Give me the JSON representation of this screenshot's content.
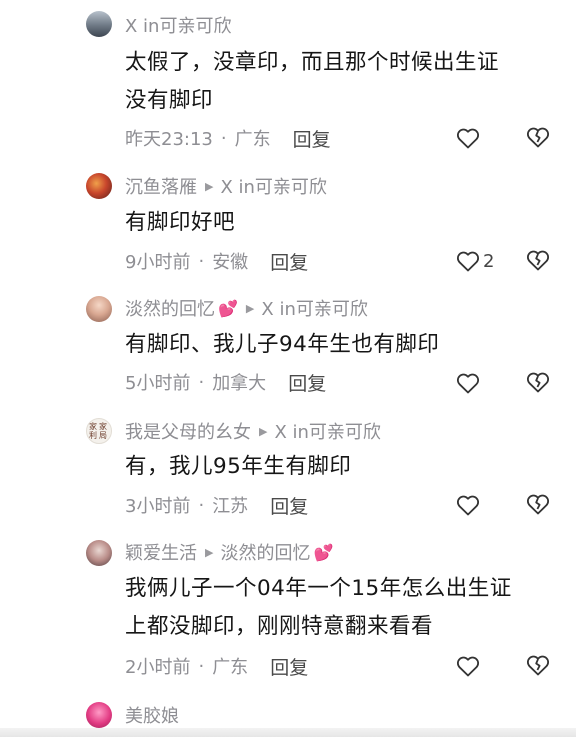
{
  "comments": [
    {
      "avatar_icon": "mountain-avatar",
      "author": "",
      "reply_to": "X in可亲可欣",
      "author_emoji": "",
      "lines": [
        "太假了，没章印，而且那个时候出生证",
        "没有脚印"
      ],
      "time": "昨天23:13",
      "location": "广东",
      "reply_label": "回复",
      "like_count": ""
    },
    {
      "avatar_icon": "flower-avatar",
      "author": "沉鱼落雁",
      "reply_to": "X in可亲可欣",
      "author_emoji": "",
      "lines": [
        "有脚印好吧"
      ],
      "time": "9小时前",
      "location": "安徽",
      "reply_label": "回复",
      "like_count": "2"
    },
    {
      "avatar_icon": "portrait-avatar",
      "author": "淡然的回忆",
      "reply_to": "X in可亲可欣",
      "author_emoji": "💕",
      "lines": [
        "有脚印、我儿子94年生也有脚印"
      ],
      "time": "5小时前",
      "location": "加拿大",
      "reply_label": "回复",
      "like_count": ""
    },
    {
      "avatar_icon": "calligraphy-avatar",
      "avatar_text": "家家利局",
      "author": "我是父母的幺女",
      "reply_to": "X in可亲可欣",
      "author_emoji": "",
      "lines": [
        "有，我儿95年生有脚印"
      ],
      "time": "3小时前",
      "location": "江苏",
      "reply_label": "回复",
      "like_count": ""
    },
    {
      "avatar_icon": "portrait-avatar",
      "author": "颖爱生活",
      "reply_to": "淡然的回忆",
      "author_emoji": "💕",
      "lines": [
        "我俩儿子一个04年一个15年怎么出生证",
        "上都没脚印，刚刚特意翻来看看"
      ],
      "time": "2小时前",
      "location": "广东",
      "reply_label": "回复",
      "like_count": ""
    },
    {
      "avatar_icon": "pink-avatar",
      "author": "美胶娘",
      "reply_to": "",
      "author_emoji": "",
      "lines": [],
      "time": "",
      "location": "",
      "reply_label": "",
      "like_count": ""
    }
  ],
  "colors": {
    "meta_text": "#8e8e93",
    "body_text": "#161616",
    "heart_emoji": "#ff6fa8"
  }
}
